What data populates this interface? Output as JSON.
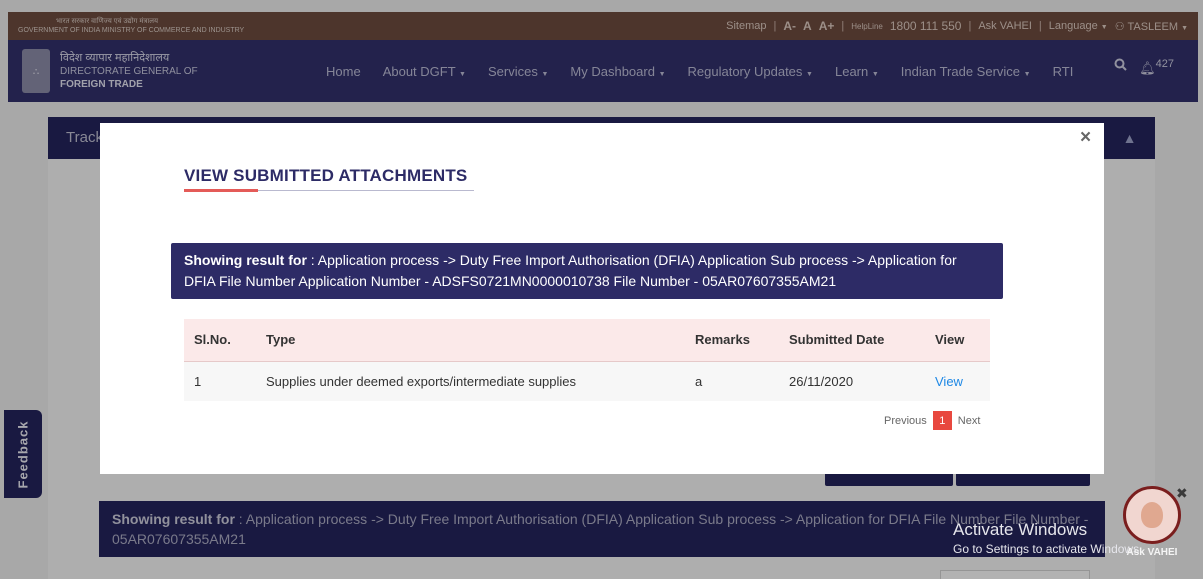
{
  "header": {
    "gov_hindi": "भारत सरकार  वाणिज्य एवं उद्योग मंत्रालय",
    "gov_english": "GOVERNMENT OF INDIA  MINISTRY OF COMMERCE AND INDUSTRY",
    "links": {
      "sitemap": "Sitemap",
      "font_small": "A-",
      "font_normal": "A",
      "font_large": "A+",
      "helpline_label": "HelpLine",
      "helpline_number": "1800 111 550",
      "ask_vahei": "Ask VAHEI",
      "language": "Language",
      "user": "TASLEEM"
    }
  },
  "brand": {
    "hindi": "विदेश व्यापार महानिदेशालय",
    "line1": "DIRECTORATE GENERAL OF",
    "line2": "FOREIGN TRADE"
  },
  "nav": {
    "items": [
      "Home",
      "About DGFT",
      "Services",
      "My Dashboard",
      "Regulatory Updates",
      "Learn",
      "Indian Trade Service",
      "RTI"
    ],
    "notification_count": "427"
  },
  "page": {
    "track_label": "Track",
    "result_prefix": "Showing result for",
    "result_text": " : Application process -> Duty Free Import Authorisation (DFIA) Application Sub process -> Application for DFIA File Number File Number - 05AR07607355AM21"
  },
  "modal": {
    "title": "VIEW SUBMITTED ATTACHMENTS",
    "info_prefix": "Showing result for",
    "info_text": " : Application process -> Duty Free Import Authorisation (DFIA) Application Sub process -> Application for DFIA File Number Application Number - ADSFS0721MN0000010738 File Number - 05AR07607355AM21",
    "table": {
      "headers": [
        "Sl.No.",
        "Type",
        "Remarks",
        "Submitted Date",
        "View"
      ],
      "rows": [
        {
          "sl": "1",
          "type": "Supplies under deemed exports/intermediate supplies",
          "remarks": "a",
          "date": "26/11/2020",
          "view": "View"
        }
      ]
    },
    "pager": {
      "previous": "Previous",
      "current": "1",
      "next": "Next"
    }
  },
  "side": {
    "feedback": "Feedback",
    "vahi_label": "Ask VAHEI"
  },
  "watermark": {
    "line1": "Activate Windows",
    "line2": "Go to Settings to activate Windows."
  }
}
